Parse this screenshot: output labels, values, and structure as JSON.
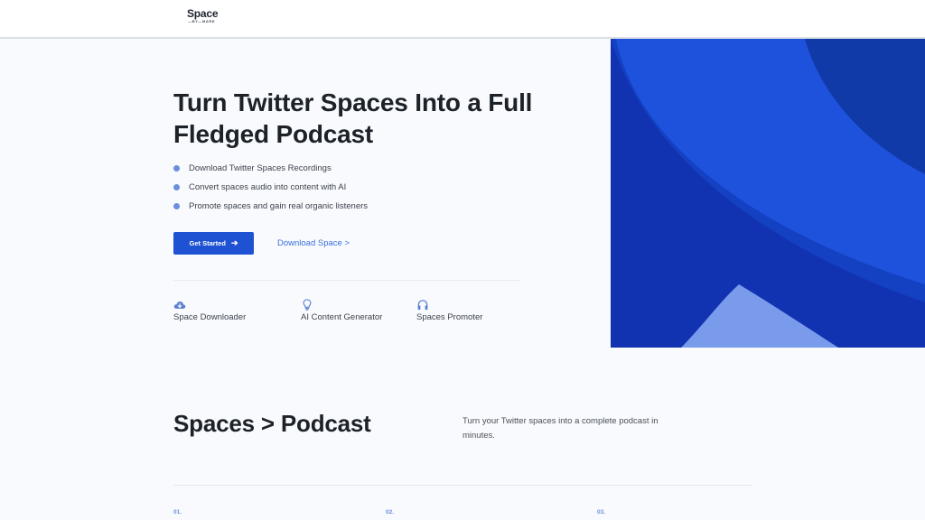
{
  "header": {
    "logo_text": "Space",
    "logo_subtext": "—BY—MARE"
  },
  "hero": {
    "title": "Turn Twitter Spaces Into a Full Fledged Podcast",
    "bullets": [
      "Download Twitter Spaces Recordings",
      "Convert spaces audio into content with AI",
      "Promote spaces and gain real organic listeners"
    ],
    "primary_button": "Get Started",
    "secondary_link": "Download Space >",
    "features": [
      {
        "icon": "cloud-download-icon",
        "label": "Space Downloader"
      },
      {
        "icon": "lightbulb-icon",
        "label": "AI Content Generator"
      },
      {
        "icon": "headphones-icon",
        "label": "Spaces Promoter"
      }
    ]
  },
  "section": {
    "title": "Spaces > Podcast",
    "description": "Turn your Twitter spaces into a complete podcast in minutes.",
    "steps": [
      "01.",
      "02.",
      "03."
    ]
  },
  "colors": {
    "accent": "#1f52d3",
    "link": "#3d6fe0",
    "bullet": "#6b8fdc",
    "art_dark": "#0f3aa8",
    "art_mid": "#1a4ad0",
    "art_light": "#7a9bec"
  }
}
